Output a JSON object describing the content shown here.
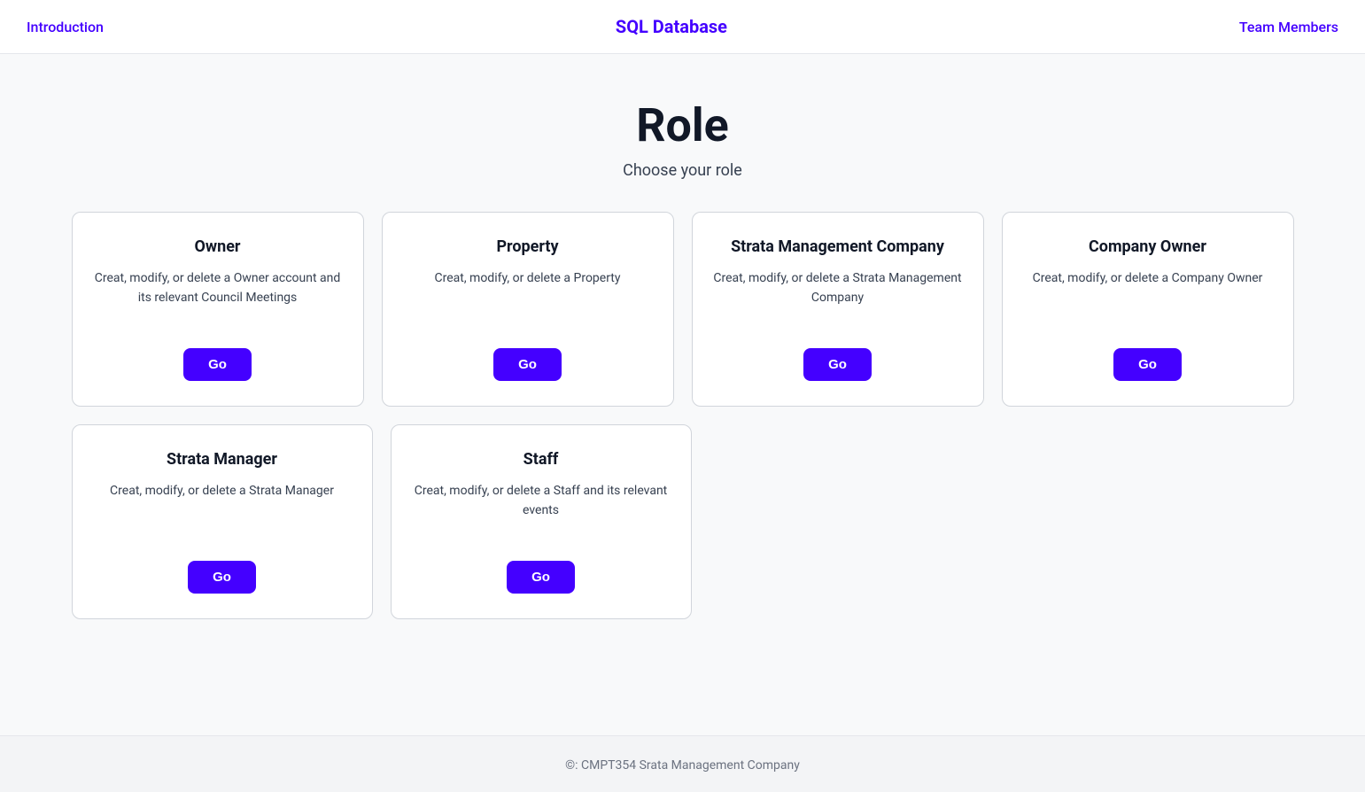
{
  "header": {
    "intro_link": "Introduction",
    "title": "SQL Database",
    "team_link": "Team Members"
  },
  "main": {
    "page_title": "Role",
    "subtitle": "Choose your role"
  },
  "cards": {
    "row1": [
      {
        "id": "owner",
        "title": "Owner",
        "description": "Creat, modify, or delete a Owner account and its relevant Council Meetings",
        "button_label": "Go"
      },
      {
        "id": "property",
        "title": "Property",
        "description": "Creat, modify, or delete a Property",
        "button_label": "Go"
      },
      {
        "id": "strata-management-company",
        "title": "Strata Management Company",
        "description": "Creat, modify, or delete a Strata Management Company",
        "button_label": "Go"
      },
      {
        "id": "company-owner",
        "title": "Company Owner",
        "description": "Creat, modify, or delete a Company Owner",
        "button_label": "Go"
      }
    ],
    "row2": [
      {
        "id": "strata-manager",
        "title": "Strata Manager",
        "description": "Creat, modify, or delete a Strata Manager",
        "button_label": "Go"
      },
      {
        "id": "staff",
        "title": "Staff",
        "description": "Creat, modify, or delete a Staff and its relevant events",
        "button_label": "Go"
      }
    ]
  },
  "footer": {
    "text": "©: CMPT354 Srata Management Company"
  }
}
